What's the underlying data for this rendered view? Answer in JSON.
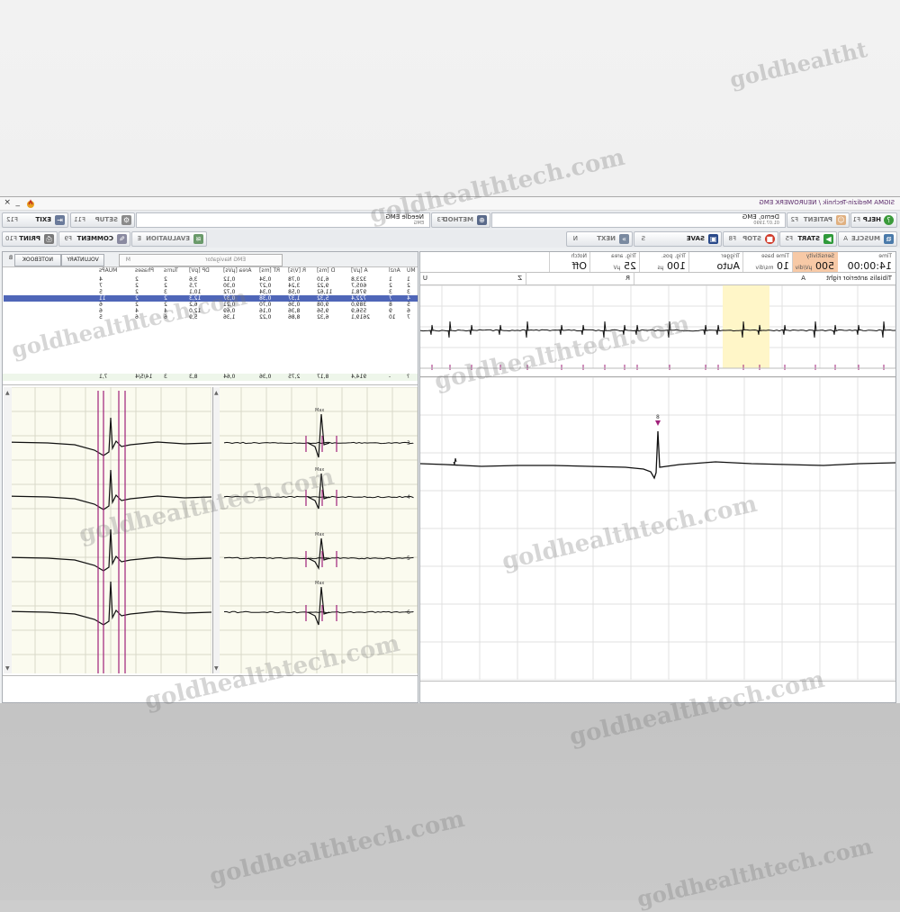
{
  "window": {
    "title": "SIGMA Medizin-Technik / NEUROWERK EMG",
    "close_glyph": "×",
    "minimize_glyph": "_"
  },
  "toolbar1": {
    "help": {
      "label": "HELP",
      "key": "F1"
    },
    "patient": {
      "label": "PATIENT",
      "key": "F2"
    },
    "patient_name": "Demo, EMG",
    "patient_date": "01.07.1990",
    "method": {
      "label": "METHOD",
      "key": "F3"
    },
    "method_name": "Needle EMG",
    "method_sub": "EMG",
    "setup": {
      "label": "SETUP",
      "key": "F11"
    },
    "exit": {
      "label": "EXIT",
      "key": "F12"
    }
  },
  "toolbar2": {
    "muscle": {
      "label": "MUSCLE",
      "key": "A"
    },
    "start": {
      "label": "START",
      "key": "F5"
    },
    "stop": {
      "label": "STOP",
      "key": "F8"
    },
    "save": {
      "label": "SAVE",
      "key": "S"
    },
    "next": {
      "label": "NEXT",
      "key": "N"
    },
    "evaluation": {
      "label": "EVALUATION",
      "key": "E"
    },
    "comment": {
      "label": "COMMENT",
      "key": "F9"
    },
    "print": {
      "label": "PRINT",
      "key": "F10"
    }
  },
  "status": {
    "time_label": "Time",
    "time_value": "14:00:00",
    "sensitivity_label": "Sensitivity",
    "sensitivity_value": "500",
    "sensitivity_unit": "µV/div",
    "timebase_label": "Time base",
    "timebase_value": "10",
    "timebase_unit": "ms/div",
    "trigger_label": "Trigger",
    "trigger_value": "Auto",
    "trigpos_label": "Trig. pos.",
    "trigpos_value": "100",
    "trigpos_unit": "µs",
    "trigarea_label": "Trig. area",
    "trigarea_value": "25",
    "trigarea_unit": "µV",
    "notch_label": "Notch",
    "notch_value": "Off"
  },
  "muscle_row": {
    "muscle": "Tibialis anterior right",
    "site": "A",
    "r_label": "R",
    "z_label": "Z",
    "u_label": "U"
  },
  "navigator": {
    "title": "EMG Navigator",
    "title_key": "M",
    "voluntary": "VOLUNTARY",
    "notebook": "NOTEBOOK",
    "notebook_key": "B"
  },
  "table": {
    "headers": [
      "MU",
      "Anzl",
      "A [µV]",
      "D [ms]",
      "R [V/s]",
      "RT [ms]",
      "Area [µVs]",
      "DP [pV]",
      "Turns",
      "Phases",
      "MUAPs"
    ],
    "rows": [
      [
        "1",
        "1",
        "323,8",
        "6,10",
        "0,78",
        "0,34",
        "0,12",
        "3,6",
        "2",
        "2",
        "4"
      ],
      [
        "2",
        "2",
        "605,7",
        "9,22",
        "3,24",
        "0,27",
        "0,30",
        "7,5",
        "2",
        "2",
        "7"
      ],
      [
        "3",
        "3",
        "978,1",
        "11,62",
        "0,58",
        "0,34",
        "0,72",
        "10,1",
        "3",
        "2",
        "5"
      ],
      [
        "4",
        "7",
        "722,4",
        "5,32",
        "1,37",
        "0,38",
        "0,37",
        "12,3",
        "2",
        "2",
        "11"
      ],
      [
        "5",
        "8",
        "389,0",
        "9,08",
        "0,36",
        "0,70",
        "0,21",
        "6,2",
        "2",
        "2",
        "6"
      ],
      [
        "6",
        "9",
        "556,9",
        "9,56",
        "8,36",
        "0,16",
        "0,69",
        "12,0",
        "4",
        "4",
        "6"
      ],
      [
        "7",
        "10",
        "2619,1",
        "6,32",
        "8,86",
        "0,22",
        "1,36",
        "5,9",
        "6",
        "6",
        "5"
      ]
    ],
    "selected_row": 3,
    "footer": [
      "?",
      "-",
      "914,4",
      "8,17",
      "2,75",
      "0,36",
      "0,64",
      "8,3",
      "3",
      "14/5/4",
      "7,1"
    ]
  },
  "traces": {
    "max_label": "Max",
    "unit_numbers": [
      "3",
      "4",
      "5",
      "6"
    ],
    "marker_label": "8",
    "scroll_up": "▲",
    "scroll_down": "▼"
  },
  "colors": {
    "accent": "#4f66b8",
    "marker": "#a0207a",
    "trace": "#111111",
    "grid": "#d8d8c8",
    "highlight": "#fff6c8"
  },
  "watermark": "goldhealthtech.com",
  "watermark_partial": "goldhealtht"
}
